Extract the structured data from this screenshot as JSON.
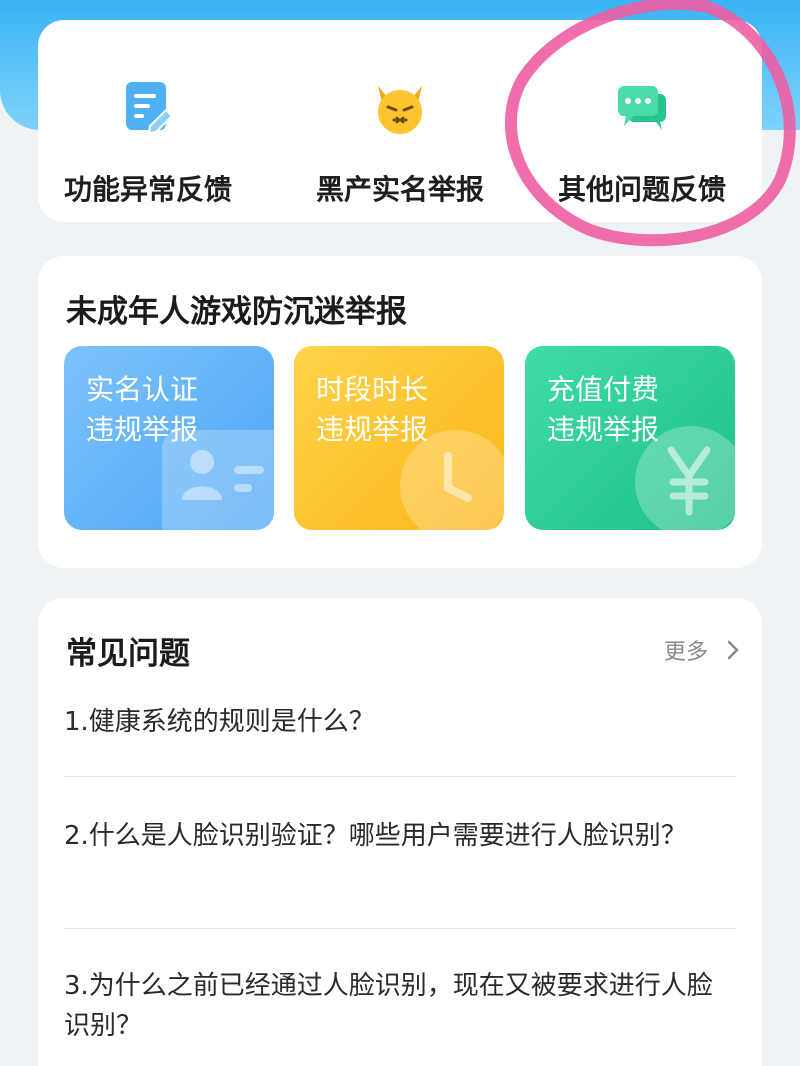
{
  "quick_actions": [
    {
      "label": "功能异常反馈",
      "icon": "edit-document-icon"
    },
    {
      "label": "黑产实名举报",
      "icon": "devil-face-icon"
    },
    {
      "label": "其他问题反馈",
      "icon": "chat-bubble-icon"
    }
  ],
  "minors": {
    "title": "未成年人游戏防沉迷举报",
    "tiles": [
      {
        "line1": "实名认证",
        "line2": "违规举报",
        "icon": "id-card-icon",
        "color": "#5aaef7"
      },
      {
        "line1": "时段时长",
        "line2": "违规举报",
        "icon": "clock-icon",
        "color": "#fcc02e"
      },
      {
        "line1": "充值付费",
        "line2": "违规举报",
        "icon": "yen-icon",
        "color": "#2ccc95"
      }
    ]
  },
  "faq": {
    "title": "常见问题",
    "more_label": "更多",
    "items": [
      "1.健康系统的规则是什么？",
      "2.什么是人脸识别验证？哪些用户需要进行人脸识别？",
      "3.为什么之前已经通过人脸识别，现在又被要求进行人脸识别？"
    ]
  },
  "colors": {
    "header_blue": "#39b4f5",
    "annotation_pink": "#ee5ea3"
  }
}
